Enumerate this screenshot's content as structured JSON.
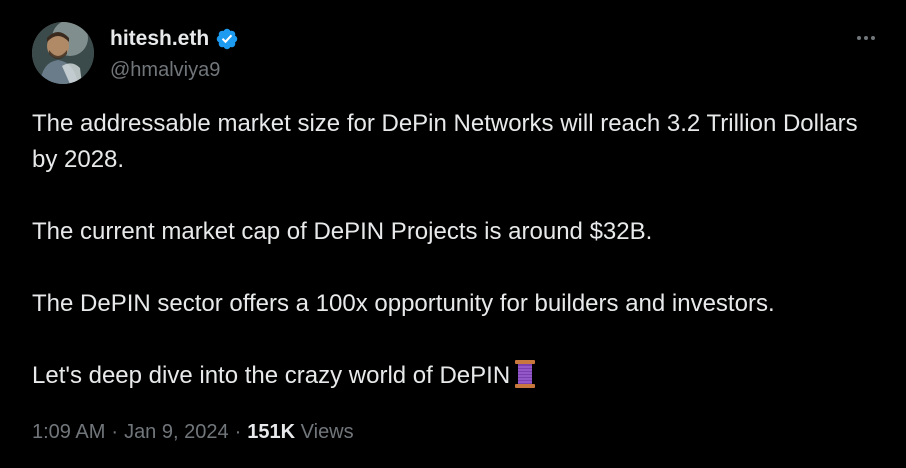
{
  "author": {
    "display_name": "hitesh.eth",
    "handle": "@hmalviya9",
    "verified": true
  },
  "tweet": {
    "paragraphs": [
      "The addressable market size for DePin Networks will reach 3.2 Trillion Dollars by 2028.",
      "The current market cap of DePIN Projects is around $32B.",
      "The DePIN sector offers a 100x opportunity for builders and investors.",
      "Let's deep dive into the crazy world of DePIN"
    ],
    "emoji_icon": "thread-spool-icon"
  },
  "meta": {
    "time": "1:09 AM",
    "separator": "·",
    "date": "Jan 9, 2024",
    "views_count": "151K",
    "views_label": "Views"
  },
  "colors": {
    "background": "#000000",
    "primary_text": "#e7e9ea",
    "secondary_text": "#71767b",
    "verified_blue": "#1d9bf0"
  }
}
